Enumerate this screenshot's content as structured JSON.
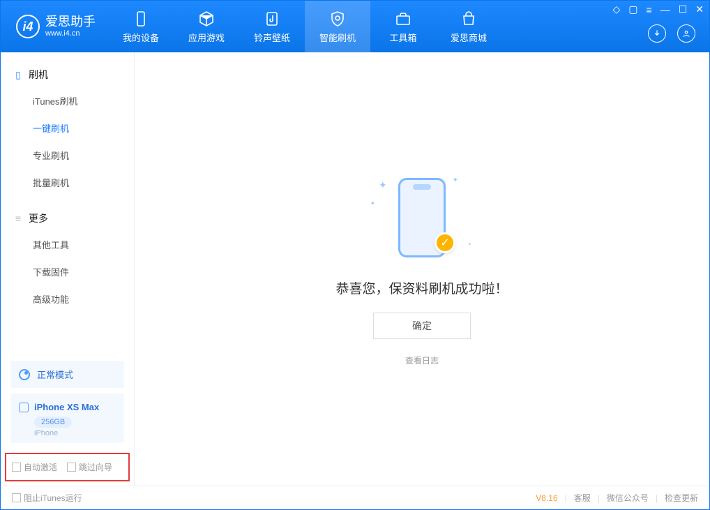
{
  "app": {
    "name_cn": "爱思助手",
    "name_en": "www.i4.cn"
  },
  "tabs": [
    {
      "id": "device",
      "label": "我的设备"
    },
    {
      "id": "apps",
      "label": "应用游戏"
    },
    {
      "id": "ringtone",
      "label": "铃声壁纸"
    },
    {
      "id": "flash",
      "label": "智能刷机"
    },
    {
      "id": "toolbox",
      "label": "工具箱"
    },
    {
      "id": "store",
      "label": "爱思商城"
    }
  ],
  "active_tab": "flash",
  "sidebar": {
    "groups": [
      {
        "title": "刷机",
        "items": [
          {
            "id": "itunes",
            "label": "iTunes刷机"
          },
          {
            "id": "onekey",
            "label": "一键刷机",
            "active": true
          },
          {
            "id": "pro",
            "label": "专业刷机"
          },
          {
            "id": "batch",
            "label": "批量刷机"
          }
        ]
      },
      {
        "title": "更多",
        "items": [
          {
            "id": "other",
            "label": "其他工具"
          },
          {
            "id": "firmware",
            "label": "下载固件"
          },
          {
            "id": "advanced",
            "label": "高级功能"
          }
        ]
      }
    ],
    "mode_label": "正常模式",
    "device": {
      "name": "iPhone XS Max",
      "capacity": "256GB",
      "type": "iPhone"
    },
    "bottom_opts": {
      "auto_activate": "自动激活",
      "skip_wizard": "跳过向导"
    }
  },
  "result": {
    "title": "恭喜您，保资料刷机成功啦！",
    "ok": "确定",
    "log_link": "查看日志"
  },
  "footer": {
    "block_itunes": "阻止iTunes运行",
    "version": "V8.16",
    "support": "客服",
    "wechat": "微信公众号",
    "update": "检查更新"
  }
}
